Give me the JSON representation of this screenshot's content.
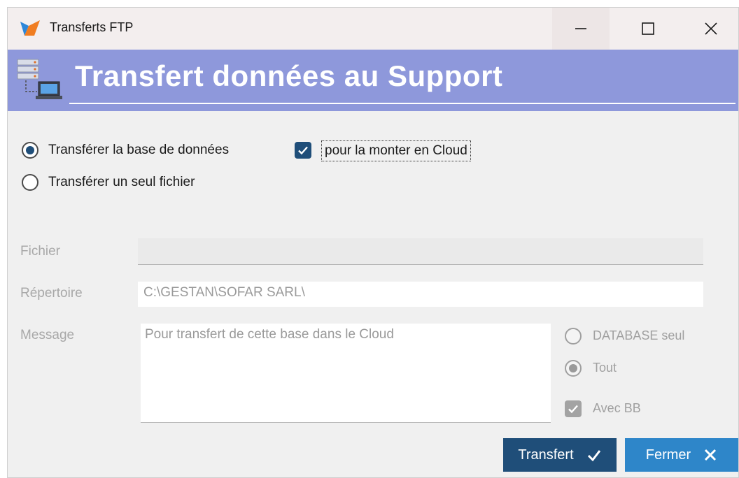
{
  "window": {
    "title": "Transferts FTP",
    "controls": {
      "minimize": "minimize-icon",
      "maximize": "maximize-icon",
      "close": "close-icon"
    }
  },
  "banner": {
    "title": "Transfert données au Support",
    "icon": "ftp-server-icon"
  },
  "options": {
    "base_label": "Transférer la base de données",
    "base_selected": true,
    "single_label": "Transférer un seul fichier",
    "single_selected": false,
    "cloud_label": "pour la monter en Cloud",
    "cloud_checked": true
  },
  "fields": {
    "fichier_label": "Fichier",
    "fichier_value": "",
    "repertoire_label": "Répertoire",
    "repertoire_value": "C:\\GESTAN\\SOFAR SARL\\",
    "message_label": "Message",
    "message_value": "Pour transfert de cette base dans le Cloud"
  },
  "side_options": {
    "database_label": "DATABASE seul",
    "database_selected": false,
    "tout_label": "Tout",
    "tout_selected": true,
    "avec_bb_label": "Avec BB",
    "avec_bb_checked": true
  },
  "buttons": {
    "transfert_label": "Transfert",
    "fermer_label": "Fermer"
  },
  "colors": {
    "banner": "#8e98db",
    "primary": "#1f4e79",
    "secondary": "#2e86c9"
  }
}
